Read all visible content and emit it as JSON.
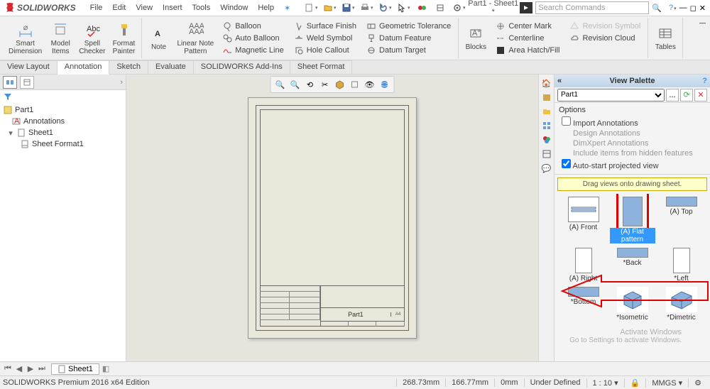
{
  "app": {
    "name": "SOLIDWORKS",
    "doc_title": "Part1 - Sheet1 *"
  },
  "menu": [
    "File",
    "Edit",
    "View",
    "Insert",
    "Tools",
    "Window",
    "Help"
  ],
  "search_placeholder": "Search Commands",
  "ribbon": {
    "big": [
      {
        "label": "Smart\nDimension"
      },
      {
        "label": "Model\nItems"
      },
      {
        "label": "Spell\nChecker"
      },
      {
        "label": "Format\nPainter"
      },
      {
        "label": "Note"
      },
      {
        "label": "Linear Note\nPattern"
      },
      {
        "label": "Blocks"
      },
      {
        "label": "Tables"
      }
    ],
    "stack1": [
      "Balloon",
      "Auto Balloon",
      "Magnetic Line"
    ],
    "stack2": [
      "Surface Finish",
      "Weld Symbol",
      "Hole Callout"
    ],
    "stack3": [
      "Geometric Tolerance",
      "Datum Feature",
      "Datum Target"
    ],
    "stack4": [
      "Center Mark",
      "Centerline",
      "Area Hatch/Fill"
    ],
    "stack5": [
      "Revision Symbol",
      "Revision Cloud"
    ]
  },
  "ribbon_tabs": [
    "View Layout",
    "Annotation",
    "Sketch",
    "Evaluate",
    "SOLIDWORKS Add-Ins",
    "Sheet Format"
  ],
  "active_ribbon_tab": "Annotation",
  "tree": {
    "root": "Part1",
    "nodes": [
      {
        "label": "Annotations",
        "indent": 1,
        "icon": "A"
      },
      {
        "label": "Sheet1",
        "indent": 1,
        "icon": "sheet",
        "expanded": true
      },
      {
        "label": "Sheet Format1",
        "indent": 2,
        "icon": "sheet"
      }
    ]
  },
  "titleblock_name": "Part1",
  "view_palette": {
    "title": "View Palette",
    "part": "Part1",
    "options_title": "Options",
    "options": {
      "import_annotations": "Import Annotations",
      "design_annotations": "Design Annotations",
      "dimxpert": "DimXpert Annotations",
      "hidden": "Include items from hidden features",
      "autostart": "Auto-start projected view"
    },
    "hint": "Drag views onto drawing sheet.",
    "views_row1": [
      {
        "label": "(A) Front",
        "filled": false
      },
      {
        "label": "(A) Flat pattern",
        "filled": true,
        "highlight": true
      },
      {
        "label": "(A) Top",
        "filled": true
      }
    ],
    "views_row2": [
      {
        "label": "(A) Right",
        "filled": false
      },
      {
        "label": "*Back",
        "filled": true
      },
      {
        "label": "*Left",
        "filled": false
      }
    ],
    "views_row3": [
      {
        "label": "*Bottom",
        "filled": true
      },
      {
        "label": "*Isometric",
        "filled": false,
        "iso": true
      },
      {
        "label": "*Dimetric",
        "filled": false,
        "iso": true
      }
    ]
  },
  "sheet_tab": "Sheet1",
  "status": {
    "edition": "SOLIDWORKS Premium 2016 x64 Edition",
    "coords": [
      "268.73mm",
      "166.77mm",
      "0mm"
    ],
    "state": "Under Defined",
    "scale": "1 : 10",
    "units": "MMGS"
  },
  "watermark": {
    "l1": "Activate Windows",
    "l2": "Go to Settings to activate Windows."
  }
}
